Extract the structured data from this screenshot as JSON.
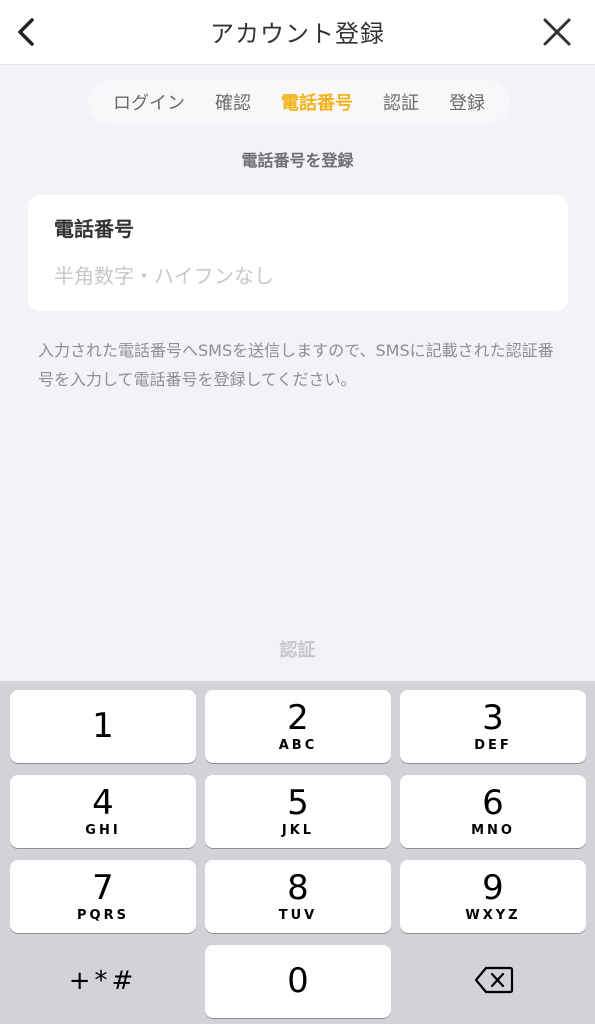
{
  "header": {
    "title": "アカウント登録",
    "back_icon": "chevron-left-icon",
    "close_icon": "close-icon"
  },
  "steps": [
    {
      "label": "ログイン",
      "active": false
    },
    {
      "label": "確認",
      "active": false
    },
    {
      "label": "電話番号",
      "active": true
    },
    {
      "label": "認証",
      "active": false
    },
    {
      "label": "登録",
      "active": false
    }
  ],
  "section_label": "電話番号を登録",
  "phone_field": {
    "label": "電話番号",
    "value": "",
    "placeholder": "半角数字・ハイフンなし"
  },
  "note": "入力された電話番号へSMSを送信しますので、SMSに記載された認証番号を入力して電話番号を登録してください。",
  "verify_button": "認証",
  "keypad": {
    "keys": [
      {
        "digit": "1",
        "letters": ""
      },
      {
        "digit": "2",
        "letters": "ABC"
      },
      {
        "digit": "3",
        "letters": "DEF"
      },
      {
        "digit": "4",
        "letters": "GHI"
      },
      {
        "digit": "5",
        "letters": "JKL"
      },
      {
        "digit": "6",
        "letters": "MNO"
      },
      {
        "digit": "7",
        "letters": "PQRS"
      },
      {
        "digit": "8",
        "letters": "TUV"
      },
      {
        "digit": "9",
        "letters": "WXYZ"
      }
    ],
    "symbols": "+*#",
    "zero": "0",
    "delete_icon": "backspace-icon"
  },
  "colors": {
    "accent": "#f3b31b",
    "background": "#f2f2f7",
    "keypad_bg": "#d1d3d9"
  }
}
